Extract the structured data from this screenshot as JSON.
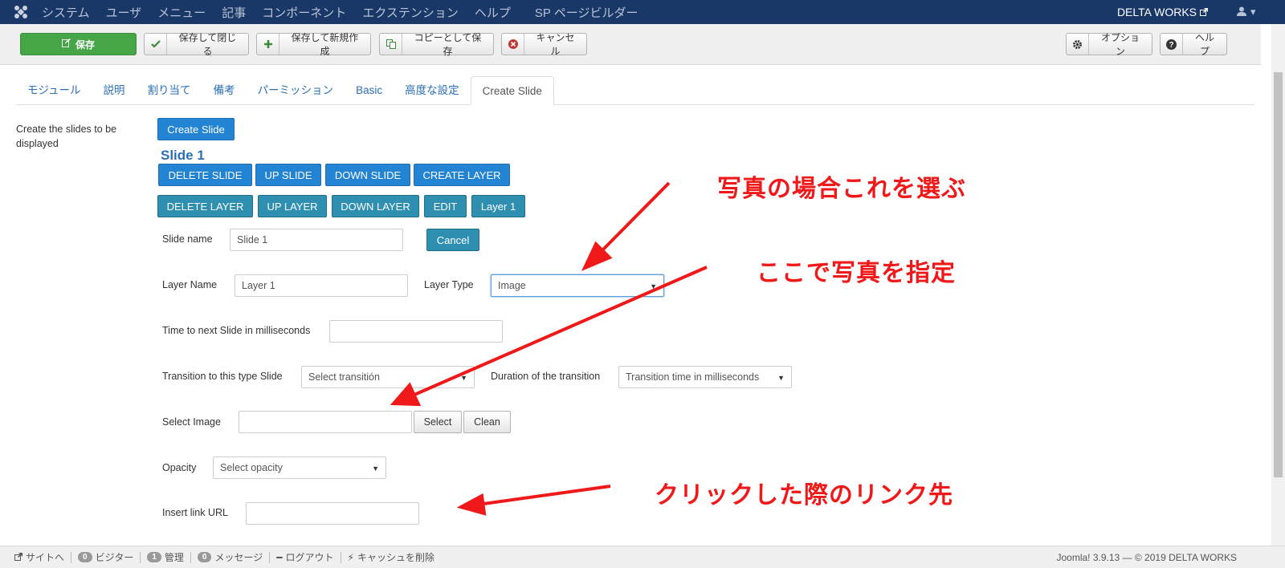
{
  "topnav": {
    "menu": [
      "システム",
      "ユーザ",
      "メニュー",
      "記事",
      "コンポーネント",
      "エクステンション",
      "ヘルプ"
    ],
    "sp_builder": "SP ページビルダー",
    "site_name": "DELTA WORKS"
  },
  "toolbar": {
    "save": "保存",
    "save_close": "保存して閉じる",
    "save_new": "保存して新規作成",
    "save_copy": "コピーとして保存",
    "cancel": "キャンセル",
    "options": "オプション",
    "help": "ヘルプ"
  },
  "tabs": [
    "モジュール",
    "説明",
    "割り当て",
    "備考",
    "パーミッション",
    "Basic",
    "高度な設定",
    "Create Slide"
  ],
  "side_desc": "Create the slides to be displayed",
  "create_slide": "Create Slide",
  "slide_title": "Slide 1",
  "slide_buttons": [
    "DELETE SLIDE",
    "UP SLIDE",
    "DOWN SLIDE",
    "CREATE LAYER"
  ],
  "layer_buttons": [
    "DELETE LAYER",
    "UP LAYER",
    "DOWN LAYER",
    "EDIT",
    "Layer 1"
  ],
  "form": {
    "slide_name_label": "Slide name",
    "slide_name_value": "Slide 1",
    "cancel": "Cancel",
    "layer_name_label": "Layer Name",
    "layer_name_value": "Layer 1",
    "layer_type_label": "Layer Type",
    "layer_type_value": "Image",
    "time_next_label": "Time to next Slide in milliseconds",
    "transition_label": "Transition to this type Slide",
    "transition_value": "Select transitión",
    "duration_label": "Duration of the transition",
    "duration_value": "Transition time in milliseconds",
    "select_image_label": "Select Image",
    "select_btn": "Select",
    "clean_btn": "Clean",
    "opacity_label": "Opacity",
    "opacity_value": "Select opacity",
    "link_label": "Insert link URL"
  },
  "annotations": {
    "a1": "写真の場合これを選ぶ",
    "a2": "ここで写真を指定",
    "a3": "クリックした際のリンク先"
  },
  "statusbar": {
    "site": "サイトへ",
    "visitors_count": "0",
    "visitors": "ビジター",
    "admin_count": "1",
    "admin": "管理",
    "messages_count": "0",
    "messages": "メッセージ",
    "logout": "ログアウト",
    "cache": "キャッシュを削除",
    "version": "Joomla! 3.9.13 — © 2019 DELTA WORKS"
  },
  "colors": {
    "nav_bg": "#1a3867",
    "save_green": "#46a546",
    "blue_btn": "#2384d3",
    "teal_btn": "#2f8fb0",
    "annotation_red": "#f01919"
  }
}
